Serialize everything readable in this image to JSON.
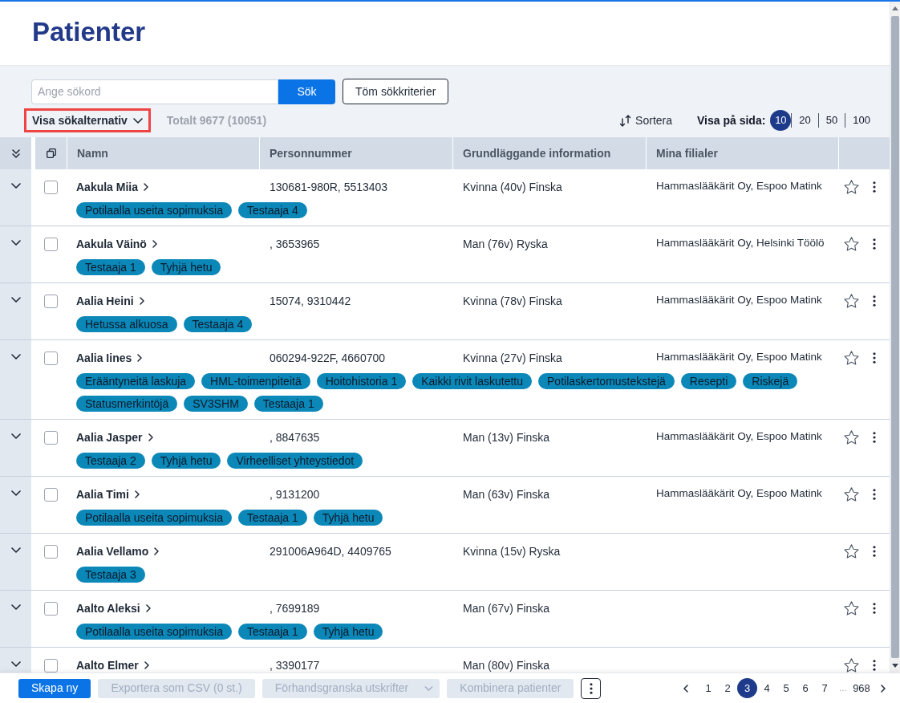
{
  "page": {
    "title": "Patienter"
  },
  "search": {
    "placeholder": "Ange sökord",
    "submit": "Sök",
    "clear": "Töm sökkriterier"
  },
  "toolbar": {
    "options_toggle": {
      "label": "Visa sökalternativ",
      "highlighted": true
    },
    "total": "Totalt 9677 (10051)",
    "sort": "Sortera",
    "page_size_label": "Visa på sida:",
    "page_sizes": [
      {
        "label": "10",
        "selected": true
      },
      {
        "label": "20",
        "selected": false
      },
      {
        "label": "50",
        "selected": false
      },
      {
        "label": "100",
        "selected": false
      }
    ]
  },
  "table": {
    "columns": [
      "Namn",
      "Personnummer",
      "Grundläggande information",
      "Mina filialer"
    ],
    "rows": [
      {
        "name": "Aakula Miia",
        "personnummer": "130681-980R, 5513403",
        "info": "Kvinna (40v) Finska",
        "branch": "Hammaslääkärit Oy, Espoo Matink",
        "tags": [
          "Potilaalla useita sopimuksia",
          "Testaaja 4"
        ],
        "checked": false,
        "starred": false
      },
      {
        "name": "Aakula Väinö",
        "personnummer": ", 3653965",
        "info": "Man (76v) Ryska",
        "branch": "Hammaslääkärit Oy, Helsinki Töölö",
        "tags": [
          "Testaaja 1",
          "Tyhjä hetu"
        ],
        "checked": false,
        "starred": false
      },
      {
        "name": "Aalia Heini",
        "personnummer": "15074, 9310442",
        "info": "Kvinna (78v) Finska",
        "branch": "Hammaslääkärit Oy, Espoo Matink",
        "tags": [
          "Hetussa alkuosa",
          "Testaaja 4"
        ],
        "checked": false,
        "starred": false
      },
      {
        "name": "Aalia Iines",
        "personnummer": "060294-922F, 4660700",
        "info": "Kvinna (27v) Finska",
        "branch": "Hammaslääkärit Oy, Espoo Matink",
        "tags": [
          "Erääntyneitä laskuja",
          "HML-toimenpiteitä",
          "Hoitohistoria 1",
          "Kaikki rivit laskutettu",
          "Potilaskertomustekstejä",
          "Resepti",
          "Riskejä",
          "Statusmerkintöjä",
          "SV3SHM",
          "Testaaja 1"
        ],
        "checked": false,
        "starred": false
      },
      {
        "name": "Aalia Jasper",
        "personnummer": ", 8847635",
        "info": "Man (13v) Finska",
        "branch": "Hammaslääkärit Oy, Espoo Matink",
        "tags": [
          "Testaaja 2",
          "Tyhjä hetu",
          "Virheelliset yhteystiedot"
        ],
        "checked": false,
        "starred": false
      },
      {
        "name": "Aalia Timi",
        "personnummer": ", 9131200",
        "info": "Man (63v) Finska",
        "branch": "Hammaslääkärit Oy, Espoo Matink",
        "tags": [
          "Potilaalla useita sopimuksia",
          "Testaaja 1",
          "Tyhjä hetu"
        ],
        "checked": false,
        "starred": false
      },
      {
        "name": "Aalia Vellamo",
        "personnummer": "291006A964D, 4409765",
        "info": "Kvinna (15v) Ryska",
        "tags": [
          "Testaaja 3"
        ],
        "checked": false,
        "starred": false
      },
      {
        "name": "Aalto Aleksi",
        "personnummer": ", 7699189",
        "info": "Man (67v) Finska",
        "tags": [
          "Potilaalla useita sopimuksia",
          "Testaaja 1",
          "Tyhjä hetu"
        ],
        "checked": false,
        "starred": false
      },
      {
        "name": "Aalto Elmer",
        "personnummer": ", 3390177",
        "info": "Man (80v) Finska",
        "checked": false,
        "starred": false
      }
    ]
  },
  "footer": {
    "buttons": [
      {
        "kind": "button",
        "label": "Skapa ny",
        "disabled": false
      },
      {
        "kind": "button",
        "label": "Exportera som CSV (0 st.)",
        "disabled": true
      },
      {
        "kind": "dropdown",
        "label": "Förhandsgranska utskrifter",
        "disabled": true
      },
      {
        "kind": "button",
        "label": "Kombinera patienter",
        "disabled": true
      },
      {
        "kind": "menu"
      }
    ],
    "pagination": {
      "pages": [
        {
          "kind": "page",
          "label": "1",
          "selected": false
        },
        {
          "kind": "page",
          "label": "2",
          "selected": false
        },
        {
          "kind": "page",
          "label": "3",
          "selected": true
        },
        {
          "kind": "page",
          "label": "4",
          "selected": false
        },
        {
          "kind": "page",
          "label": "5",
          "selected": false
        },
        {
          "kind": "page",
          "label": "6",
          "selected": false
        },
        {
          "kind": "page",
          "label": "7",
          "selected": false
        },
        {
          "kind": "ellipsis",
          "label": "…",
          "selected": false
        },
        {
          "kind": "page",
          "label": "968",
          "selected": false
        }
      ]
    }
  }
}
